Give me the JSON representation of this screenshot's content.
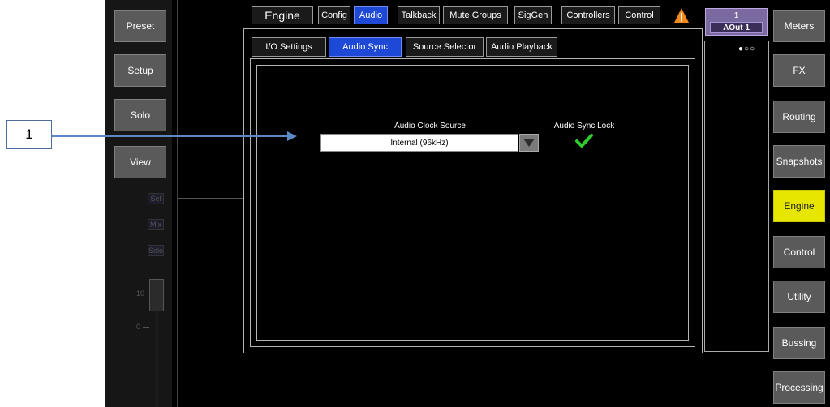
{
  "left_buttons": [
    "Preset",
    "Setup",
    "Solo",
    "View"
  ],
  "strip_indicators": [
    "Sel",
    "Mix",
    "Solo"
  ],
  "fader_labels": {
    "ten": "10",
    "zero": "0"
  },
  "top_tabs": [
    {
      "label": "Engine",
      "active": false
    },
    {
      "label": "Config",
      "active": false
    },
    {
      "label": "Audio",
      "active": true
    },
    {
      "label": "Talkback",
      "active": false
    },
    {
      "label": "Mute Groups",
      "active": false
    },
    {
      "label": "SigGen",
      "active": false
    },
    {
      "label": "Controllers",
      "active": false
    },
    {
      "label": "Control",
      "active": false
    }
  ],
  "sub_tabs": [
    {
      "label": "I/O Settings",
      "active": false
    },
    {
      "label": "Audio Sync",
      "active": true
    },
    {
      "label": "Source Selector",
      "active": false
    },
    {
      "label": "Audio Playback",
      "active": false
    }
  ],
  "channel": {
    "number": "1",
    "name": "AOut 1"
  },
  "page_dots": "●○○",
  "audio_sync": {
    "clock_source_label": "Audio Clock Source",
    "clock_source_value": "Internal (96kHz)",
    "lock_label": "Audio Sync Lock",
    "lock_status": "locked",
    "lock_icon": "checkmark-icon"
  },
  "right_buttons": [
    {
      "label": "Meters",
      "active": false
    },
    {
      "label": "FX",
      "active": false
    },
    {
      "label": "Routing",
      "active": false
    },
    {
      "label": "Snapshots",
      "active": false
    },
    {
      "label": "Engine",
      "active": true
    },
    {
      "label": "Control",
      "active": false
    },
    {
      "label": "Utility",
      "active": false
    },
    {
      "label": "Bussing",
      "active": false
    },
    {
      "label": "Processing",
      "active": false
    }
  ],
  "callout": {
    "number": "1"
  },
  "colors": {
    "active_tab": "#1e49d6",
    "active_side": "#e6e600",
    "side_button": "#5a5a5a",
    "warning": "#f08a1c",
    "lock_ok": "#2ecc2e",
    "callout_line": "#5b89c6"
  }
}
